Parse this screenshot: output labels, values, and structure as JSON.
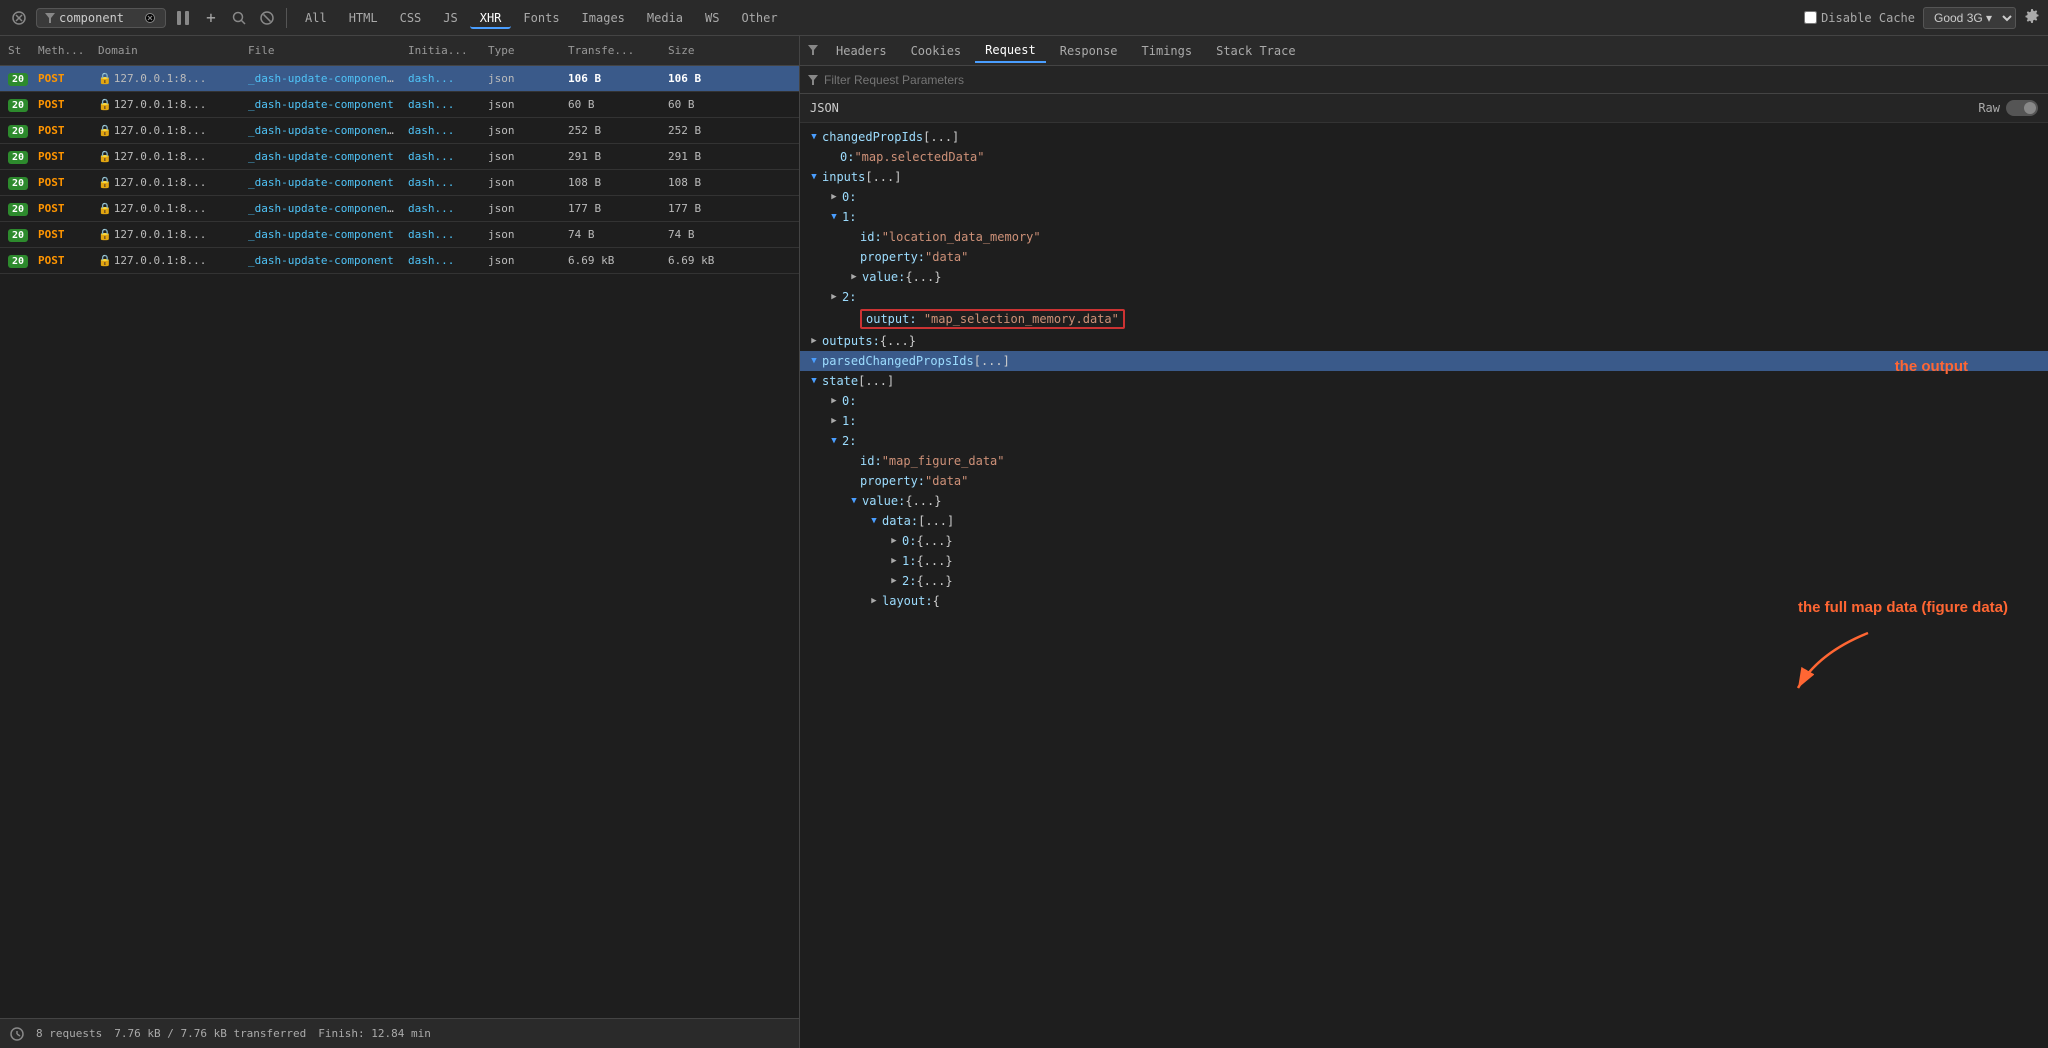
{
  "toolbar": {
    "filter_placeholder": "component",
    "nav_tabs": [
      "All",
      "HTML",
      "CSS",
      "JS",
      "XHR",
      "Fonts",
      "Images",
      "Media",
      "WS",
      "Other"
    ],
    "active_tab": "XHR",
    "disable_cache_label": "Disable Cache",
    "network_label": "Good 3G",
    "filter_icon": "▼",
    "clear_icon": "⊘",
    "search_icon": "🔍",
    "block_icon": "⊘",
    "pause_icon": "⏸",
    "add_icon": "+"
  },
  "table": {
    "headers": [
      "St",
      "Meth...",
      "Domain",
      "File",
      "Initia...",
      "Type",
      "Transfe...",
      "Size"
    ],
    "rows": [
      {
        "status": "20",
        "method": "POST",
        "domain": "127.0.0.1:8...",
        "file": "_dash-update-componen",
        "initiator": "dash...",
        "type": "json",
        "transfer": "106 B",
        "size": "106 B",
        "selected": true,
        "has_lock": true,
        "has_arrow": true
      },
      {
        "status": "20",
        "method": "POST",
        "domain": "127.0.0.1:8...",
        "file": "_dash-update-component",
        "initiator": "dash...",
        "type": "json",
        "transfer": "60 B",
        "size": "60 B",
        "selected": false,
        "has_lock": true,
        "has_arrow": false
      },
      {
        "status": "20",
        "method": "POST",
        "domain": "127.0.0.1:8...",
        "file": "_dash-update-componen",
        "initiator": "dash...",
        "type": "json",
        "transfer": "252 B",
        "size": "252 B",
        "selected": false,
        "has_lock": true,
        "has_arrow": true
      },
      {
        "status": "20",
        "method": "POST",
        "domain": "127.0.0.1:8...",
        "file": "_dash-update-component",
        "initiator": "dash...",
        "type": "json",
        "transfer": "291 B",
        "size": "291 B",
        "selected": false,
        "has_lock": true,
        "has_arrow": false
      },
      {
        "status": "20",
        "method": "POST",
        "domain": "127.0.0.1:8...",
        "file": "_dash-update-component",
        "initiator": "dash...",
        "type": "json",
        "transfer": "108 B",
        "size": "108 B",
        "selected": false,
        "has_lock": true,
        "has_arrow": false
      },
      {
        "status": "20",
        "method": "POST",
        "domain": "127.0.0.1:8...",
        "file": "_dash-update-componen",
        "initiator": "dash...",
        "type": "json",
        "transfer": "177 B",
        "size": "177 B",
        "selected": false,
        "has_lock": true,
        "has_arrow": true
      },
      {
        "status": "20",
        "method": "POST",
        "domain": "127.0.0.1:8...",
        "file": "_dash-update-component",
        "initiator": "dash...",
        "type": "json",
        "transfer": "74 B",
        "size": "74 B",
        "selected": false,
        "has_lock": true,
        "has_arrow": false
      },
      {
        "status": "20",
        "method": "POST",
        "domain": "127.0.0.1:8...",
        "file": "_dash-update-component",
        "initiator": "dash...",
        "type": "json",
        "transfer": "6.69 kB",
        "size": "6.69 kB",
        "selected": false,
        "has_lock": true,
        "has_arrow": false
      }
    ]
  },
  "status_bar": {
    "requests": "8 requests",
    "transfer": "7.76 kB / 7.76 kB transferred",
    "finish": "Finish: 12.84 min"
  },
  "detail": {
    "tabs": [
      "Headers",
      "Cookies",
      "Request",
      "Response",
      "Timings",
      "Stack Trace"
    ],
    "active_tab": "Request",
    "filter_placeholder": "Filter Request Parameters",
    "json_label": "JSON",
    "raw_label": "Raw",
    "tree": [
      {
        "indent": 0,
        "type": "expandable",
        "expanded": true,
        "key": "changedPropIds",
        "value": "[...]",
        "highlighted": false
      },
      {
        "indent": 1,
        "type": "value",
        "key": "0:",
        "value": "\"map.selectedData\"",
        "highlighted": false
      },
      {
        "indent": 0,
        "type": "expandable",
        "expanded": true,
        "key": "inputs",
        "value": "[...]",
        "highlighted": false
      },
      {
        "indent": 1,
        "type": "expandable",
        "expanded": false,
        "key": "0:",
        "value": "",
        "highlighted": false
      },
      {
        "indent": 1,
        "type": "expandable",
        "expanded": true,
        "key": "1:",
        "value": "",
        "highlighted": false
      },
      {
        "indent": 2,
        "type": "value",
        "key": "id:",
        "value": "\"location_data_memory\"",
        "highlighted": false
      },
      {
        "indent": 2,
        "type": "value",
        "key": "property:",
        "value": "\"data\"",
        "highlighted": false
      },
      {
        "indent": 2,
        "type": "expandable",
        "expanded": false,
        "key": "value:",
        "value": "{...}",
        "highlighted": false
      },
      {
        "indent": 1,
        "type": "expandable",
        "expanded": false,
        "key": "2:",
        "value": "",
        "highlighted": false
      },
      {
        "indent": 2,
        "type": "output",
        "key": "output:",
        "value": "\"map_selection_memory.data\"",
        "highlighted": false
      },
      {
        "indent": 0,
        "type": "expandable",
        "expanded": false,
        "key": "outputs:",
        "value": "{...}",
        "highlighted": false
      },
      {
        "indent": 0,
        "type": "expandable",
        "expanded": true,
        "key": "parsedChangedPropsIds",
        "value": "[...]",
        "highlighted": true
      },
      {
        "indent": 0,
        "type": "expandable",
        "expanded": true,
        "key": "state",
        "value": "[...]",
        "highlighted": false
      },
      {
        "indent": 1,
        "type": "expandable",
        "expanded": false,
        "key": "0:",
        "value": "",
        "highlighted": false
      },
      {
        "indent": 1,
        "type": "expandable",
        "expanded": false,
        "key": "1:",
        "value": "",
        "highlighted": false
      },
      {
        "indent": 1,
        "type": "expandable",
        "expanded": true,
        "key": "2:",
        "value": "",
        "highlighted": false
      },
      {
        "indent": 2,
        "type": "value",
        "key": "id:",
        "value": "\"map_figure_data\"",
        "highlighted": false
      },
      {
        "indent": 2,
        "type": "value",
        "key": "property:",
        "value": "\"data\"",
        "highlighted": false
      },
      {
        "indent": 2,
        "type": "expandable",
        "expanded": true,
        "key": "value:",
        "value": "{...}",
        "highlighted": false
      },
      {
        "indent": 3,
        "type": "expandable",
        "expanded": true,
        "key": "data:",
        "value": "[...]",
        "highlighted": false
      },
      {
        "indent": 4,
        "type": "expandable",
        "expanded": false,
        "key": "0:",
        "value": "{...}",
        "highlighted": false
      },
      {
        "indent": 4,
        "type": "expandable",
        "expanded": false,
        "key": "1:",
        "value": "{...}",
        "highlighted": false
      },
      {
        "indent": 4,
        "type": "expandable",
        "expanded": false,
        "key": "2:",
        "value": "{...}",
        "highlighted": false
      },
      {
        "indent": 3,
        "type": "expandable",
        "expanded": false,
        "key": "layout:",
        "value": "{",
        "highlighted": false
      }
    ],
    "annotations": {
      "output_label": "the output",
      "map_data_label": "the full map data (figure data)"
    }
  }
}
